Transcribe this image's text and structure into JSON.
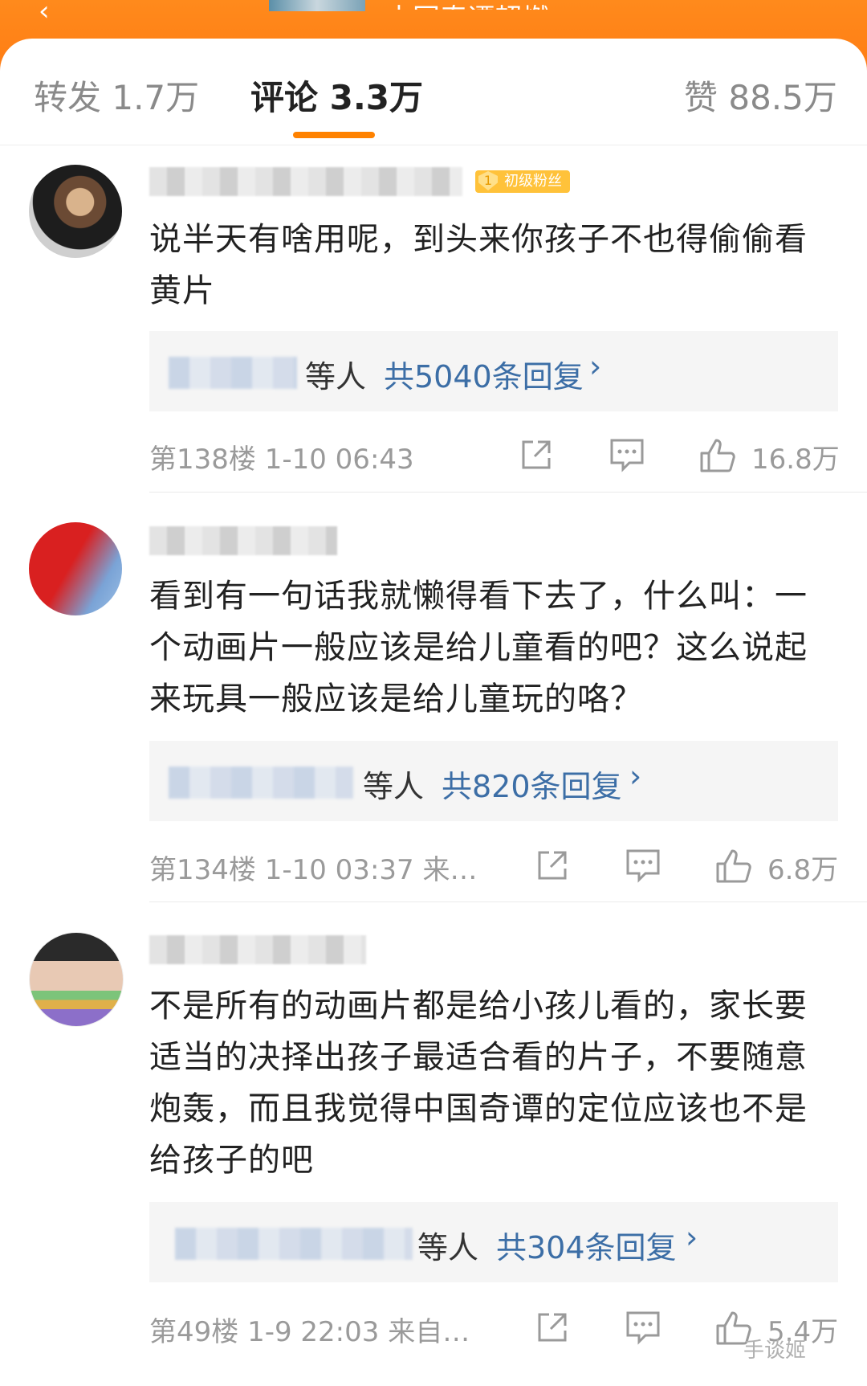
{
  "header": {
    "title": "中国奇谭超燃"
  },
  "tabs": [
    {
      "label": "转发 1.7万"
    },
    {
      "label": "评论 3.3万"
    },
    {
      "label": "赞 88.5万"
    }
  ],
  "comments": [
    {
      "badge": "初级粉丝",
      "badge_level": "1",
      "text": "说半天有啥用呢，到头来你孩子不也得偷偷看黄片",
      "reply_people": "等人",
      "reply_count": "共5040条回复",
      "floor": "第138楼  1-10 06:43",
      "likes": "16.8万"
    },
    {
      "text": "看到有一句话我就懒得看下去了，什么叫：一个动画片一般应该是给儿童看的吧？这么说起来玩具一般应该是给儿童玩的咯？",
      "reply_people": "等人",
      "reply_count": "共820条回复",
      "floor": "第134楼  1-10 03:37  来…",
      "likes": "6.8万"
    },
    {
      "text": "不是所有的动画片都是给小孩儿看的，家长要适当的决择出孩子最适合看的片子，不要随意炮轰，而且我觉得中国奇谭的定位应该也不是给孩子的吧",
      "reply_people": "等人",
      "reply_count": "共304条回复",
      "floor": "第49楼  1-9 22:03  来自…",
      "likes": "5.4万"
    }
  ],
  "watermark": "手谈姬",
  "colors": {
    "accent": "#ff8200",
    "link": "#3c6ea6",
    "header": "#ff7a12"
  }
}
